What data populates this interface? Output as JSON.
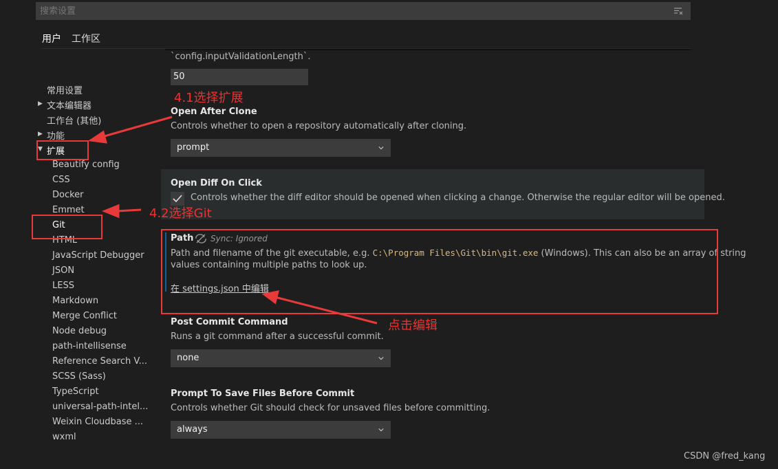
{
  "search": {
    "placeholder": "搜索设置"
  },
  "tabs": [
    {
      "label": "用户"
    },
    {
      "label": "工作区"
    }
  ],
  "toc": {
    "top": [
      {
        "label": "常用设置"
      },
      {
        "label": "文本编辑器"
      },
      {
        "label": "工作台 (其他)"
      },
      {
        "label": "功能"
      },
      {
        "label": "扩展"
      }
    ],
    "extensions": [
      "Beautify config",
      "CSS",
      "Docker",
      "Emmet",
      "Git",
      "HTML",
      "JavaScript Debugger",
      "JSON",
      "LESS",
      "Markdown",
      "Merge Conflict",
      "Node debug",
      "path-intellisense",
      "Reference Search V...",
      "SCSS (Sass)",
      "TypeScript",
      "universal-path-intel...",
      "Weixin Cloudbase ...",
      "wxml"
    ]
  },
  "settings": {
    "validation": {
      "desc": "`config.inputValidationLength`.",
      "value": "50"
    },
    "open_after_clone": {
      "title": "Open After Clone",
      "desc": "Controls whether to open a repository automatically after cloning.",
      "value": "prompt"
    },
    "open_diff": {
      "title": "Open Diff On Click",
      "desc": "Controls whether the diff editor should be opened when clicking a change. Otherwise the regular editor will be opened.",
      "checked": true
    },
    "path": {
      "title": "Path",
      "sync": "Sync: Ignored",
      "desc1_pre": "Path and filename of the git executable, e.g. ",
      "desc1_code": "C:\\Program Files\\Git\\bin\\git.exe",
      "desc1_post": " (Windows). This can also be an array of string",
      "desc2": "values containing multiple paths to look up.",
      "link": "在 settings.json 中编辑"
    },
    "post_commit": {
      "title": "Post Commit Command",
      "desc": "Runs a git command after a successful commit.",
      "value": "none"
    },
    "prompt_save": {
      "title": "Prompt To Save Files Before Commit",
      "desc": "Controls whether Git should check for unsaved files before committing.",
      "value": "always"
    }
  },
  "annotations": {
    "a1": "4.1选择扩展",
    "a2": "4.2选择Git",
    "a3": "点击编辑",
    "color": "#f03030"
  },
  "watermark": "CSDN @fred_kang"
}
